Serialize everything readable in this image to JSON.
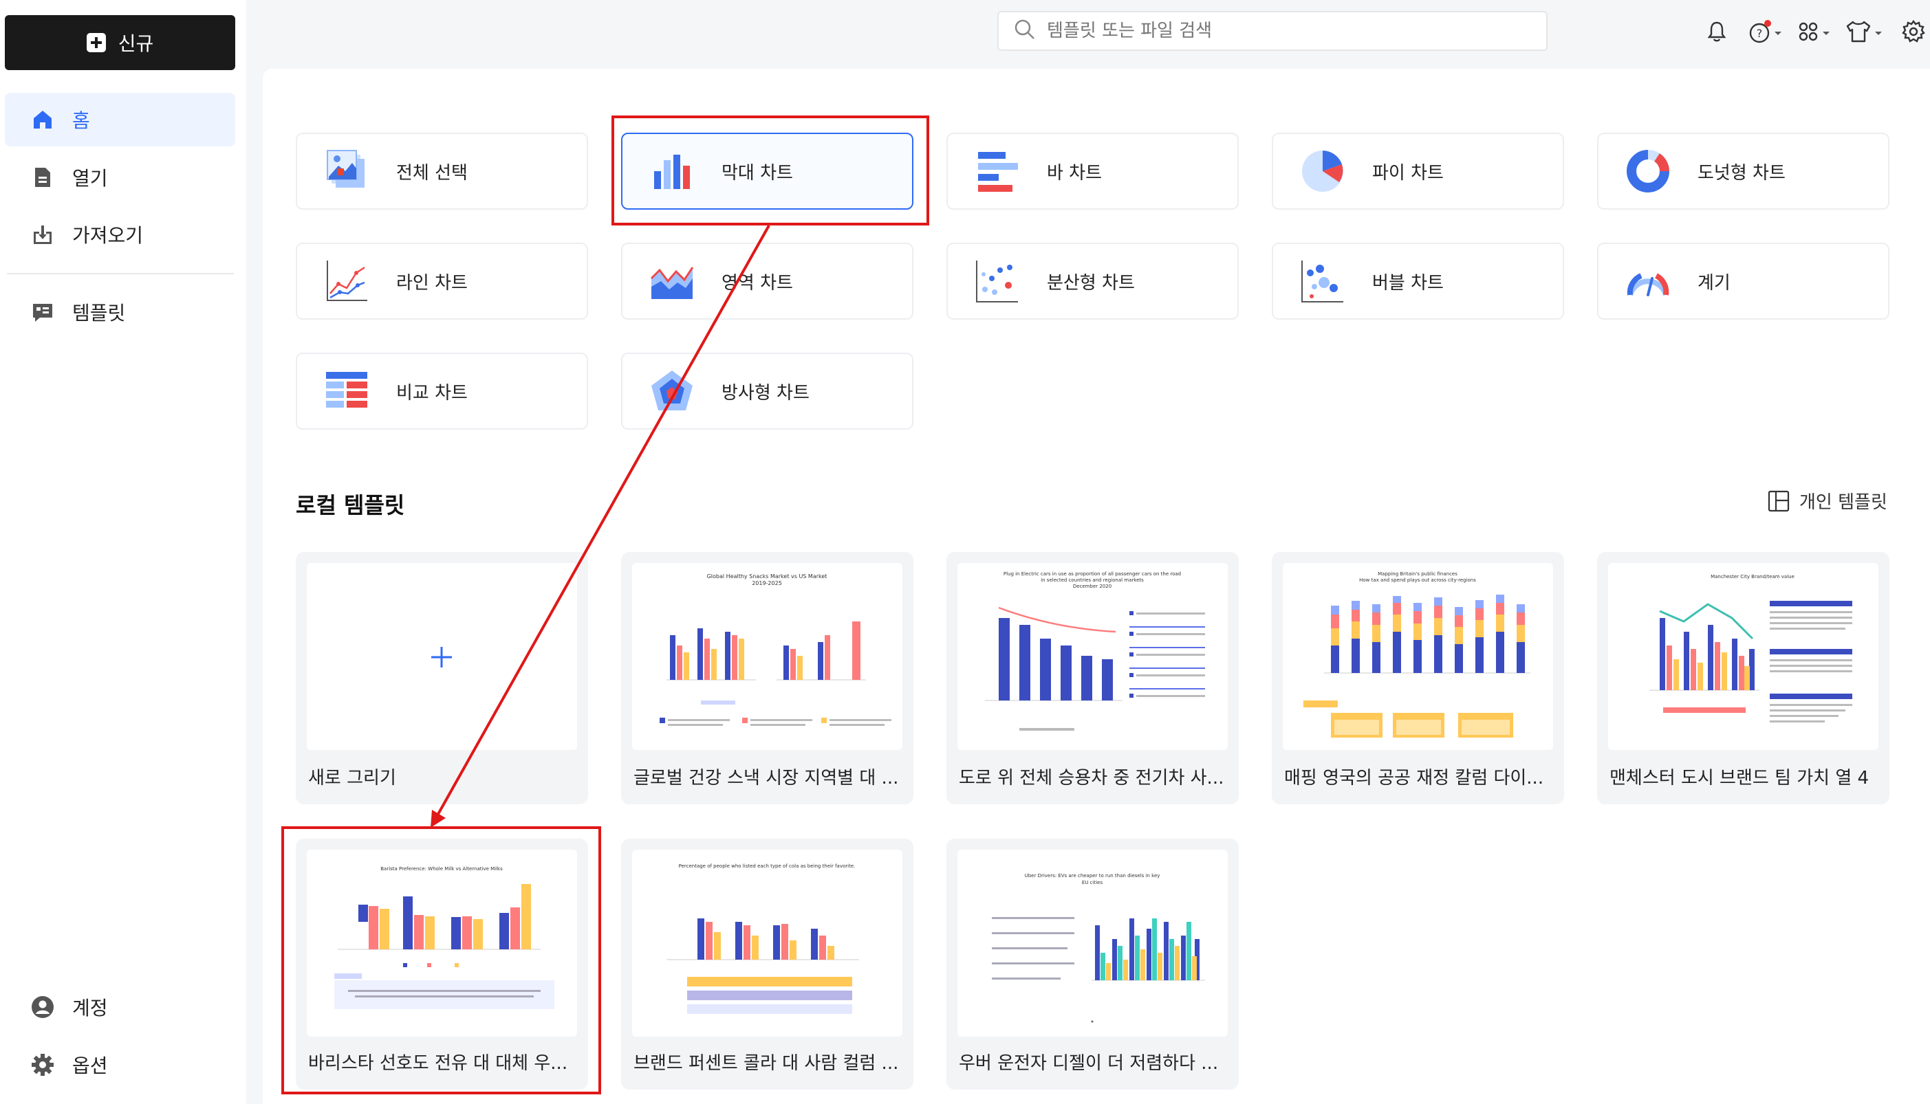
{
  "sidebar": {
    "new_label": "신규",
    "items": [
      {
        "label": "홈",
        "icon": "home-icon",
        "active": true
      },
      {
        "label": "열기",
        "icon": "document-icon"
      },
      {
        "label": "가져오기",
        "icon": "import-icon"
      },
      {
        "label": "템플릿",
        "icon": "template-icon"
      },
      {
        "label": "계정",
        "icon": "account-icon"
      },
      {
        "label": "옵션",
        "icon": "gear-icon"
      }
    ]
  },
  "topbar": {
    "search_placeholder": "템플릿 또는 파일 검색",
    "icons": [
      "bell-icon",
      "help-icon",
      "apps-icon",
      "shirt-icon",
      "settings-icon"
    ]
  },
  "chart_types": [
    {
      "label": "전체 선택",
      "icon": "select-all-icon"
    },
    {
      "label": "막대 차트",
      "icon": "column-chart-icon",
      "selected": true
    },
    {
      "label": "바 차트",
      "icon": "bar-chart-icon"
    },
    {
      "label": "파이 차트",
      "icon": "pie-chart-icon"
    },
    {
      "label": "도넛형 차트",
      "icon": "donut-chart-icon"
    },
    {
      "label": "라인 차트",
      "icon": "line-chart-icon"
    },
    {
      "label": "영역 차트",
      "icon": "area-chart-icon"
    },
    {
      "label": "분산형 차트",
      "icon": "scatter-chart-icon"
    },
    {
      "label": "버블 차트",
      "icon": "bubble-chart-icon"
    },
    {
      "label": "계기",
      "icon": "gauge-icon"
    },
    {
      "label": "비교 차트",
      "icon": "comparison-chart-icon"
    },
    {
      "label": "방사형 차트",
      "icon": "radar-chart-icon"
    }
  ],
  "local_templates": {
    "title": "로컬 템플릿",
    "personal_label": "개인 템플릿",
    "new_drawing_label": "새로 그리기",
    "cards": [
      {
        "label": "글로벌 건강 스낵 시장 지역별 대 ...",
        "thumb_title": "Global Healthy Snacks Market vs US Market 2019-2025"
      },
      {
        "label": "도로 위 전체 승용차 중 전기차 사...",
        "thumb_title": "Plug in Electric cars in use as proportion of all passenger cars on the road in selected countries and regional markets December 2020"
      },
      {
        "label": "매핑 영국의 공공 재정 칼럼 다이...",
        "thumb_title": "Mapping Britain's public finances How tax and spend plays out across city-regions"
      },
      {
        "label": "맨체스터 도시 브랜드 팀 가치 열 4",
        "thumb_title": "Manchester City Brand/team value"
      },
      {
        "label": "바리스타 선호도 전유 대 대체 우...",
        "thumb_title": "Barista Preference: Whole Milk vs Alternative Milks"
      },
      {
        "label": "브랜드 퍼센트 콜라 대 사람 컬럼 ...",
        "thumb_title": "Percentage of people who listed each type of cola as being their favorite."
      },
      {
        "label": "우버 운전자 디젤이 더 저렴하다 ...",
        "thumb_title": "Uber Drivers: EVs are cheaper to run than diesels in key EU cities"
      }
    ]
  }
}
